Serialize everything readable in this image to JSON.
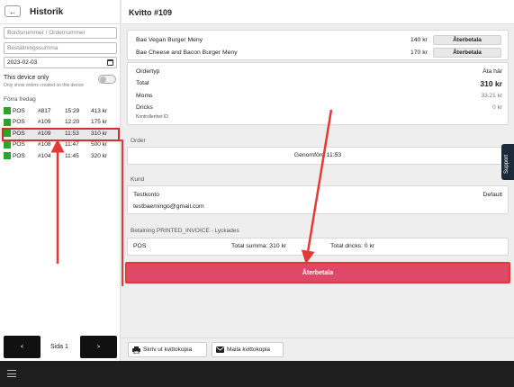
{
  "history": {
    "title": "Historik",
    "back_icon": "←",
    "search_placeholder": "Bordsnummer / Ordernummer",
    "amount_placeholder": "Beställningssumma",
    "date_value": "2023-02-03",
    "device_only_label": "This device only",
    "device_only_sub": "Only show orders created on this device",
    "section_label": "Förra fredag",
    "orders": [
      {
        "type": "POS",
        "number": "#817",
        "time": "15:29",
        "amount": "413 kr"
      },
      {
        "type": "POS",
        "number": "#109",
        "time": "12:20",
        "amount": "175 kr"
      },
      {
        "type": "POS",
        "number": "#109",
        "time": "11:53",
        "amount": "310 kr"
      },
      {
        "type": "POS",
        "number": "#108",
        "time": "11:47",
        "amount": "500 kr"
      },
      {
        "type": "POS",
        "number": "#104",
        "time": "11:45",
        "amount": "320 kr"
      }
    ],
    "pagination": {
      "prev": "<",
      "page_label": "Sida 1",
      "next": ">"
    }
  },
  "receipt": {
    "title": "Kvitto #109",
    "items": [
      {
        "name": "Bae Vegan Burger Meny",
        "price": "140 kr",
        "action": "Återbetala"
      },
      {
        "name": "Bae Cheese and Bacon Burger Meny",
        "price": "170 kr",
        "action": "Återbetala"
      }
    ],
    "order_type_label": "Ordertyp",
    "order_type_value": "Äta här",
    "total_label": "Total",
    "total_value": "310 kr",
    "vat_label": "Moms",
    "vat_value": "33,21 kr",
    "tips_label": "Dricks",
    "tips_value": "0 kr",
    "control_unit_label": "Kontrollenhet ID",
    "order_section": "Order",
    "order_status": "Genomförd 11:53",
    "customer_section": "Kund",
    "customer_name": "Testkonto",
    "customer_tag": "Default",
    "customer_email": "testbaemingo@gmail.com",
    "payment_section": "Betalning PRINTED_INVOICE - Lyckades",
    "payment_method": "POS",
    "payment_total": "Total summa: 310 kr",
    "payment_tips": "Total dricks: 0 kr",
    "refund_button": "Återbetala",
    "print_copy": "Skriv ut kvittokopia",
    "mail_copy": "Maila kvittokopia",
    "support": "Support"
  },
  "colors": {
    "accent_red": "#e04868",
    "annotation_red": "#e53935",
    "status_green": "#2aa52a"
  }
}
